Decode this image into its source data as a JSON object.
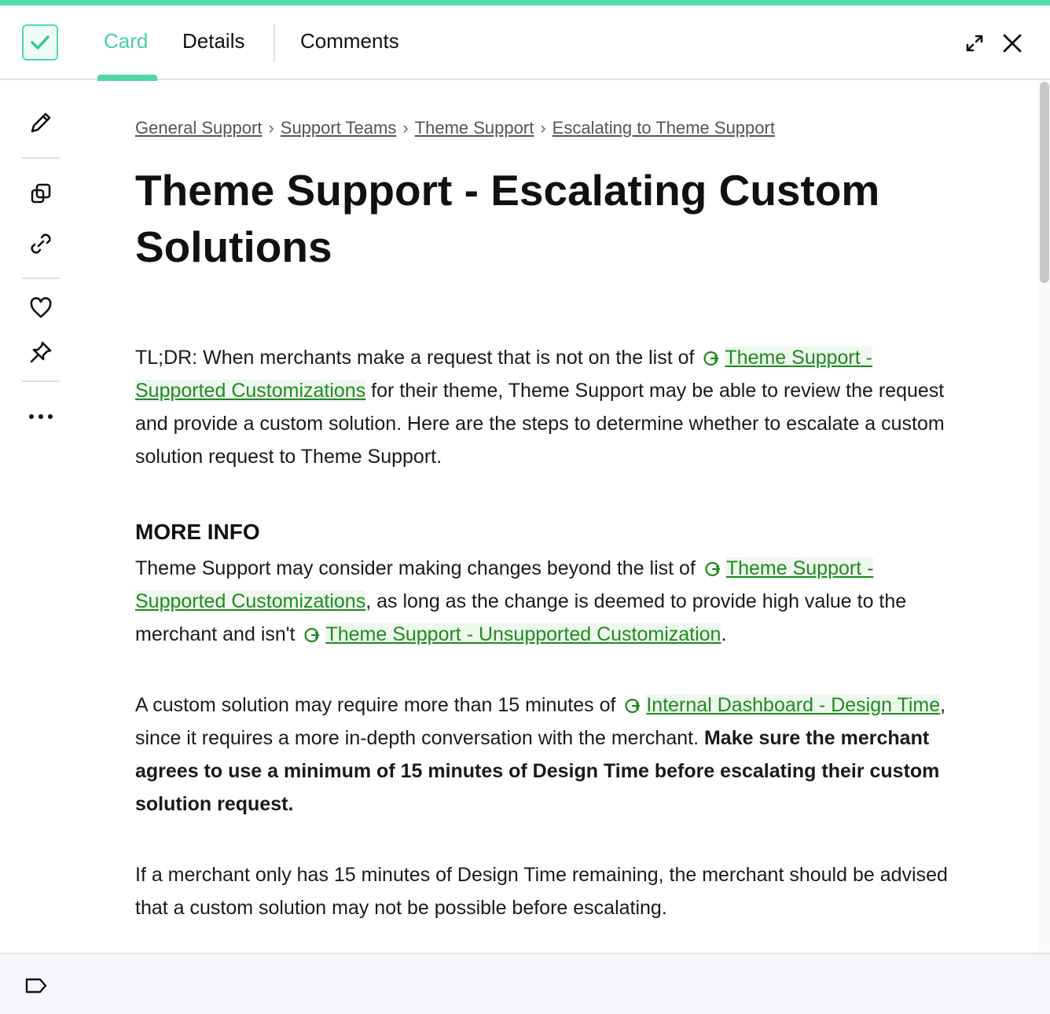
{
  "accent_color": "#4fdcb0",
  "link_color": "#1f8a1f",
  "header": {
    "tabs": [
      {
        "label": "Card",
        "active": true
      },
      {
        "label": "Details",
        "active": false
      },
      {
        "label": "Comments",
        "active": false
      }
    ],
    "icons": [
      "verified-check-icon",
      "expand-icon",
      "close-icon"
    ]
  },
  "sidebar": {
    "icons": [
      "pencil-icon",
      "copy-icon",
      "link-icon",
      "heart-icon",
      "pin-icon",
      "more-icon"
    ]
  },
  "breadcrumb": {
    "items": [
      "General Support",
      "Support Teams",
      "Theme Support",
      "Escalating to Theme Support"
    ],
    "separator": "›"
  },
  "card": {
    "title": "Theme Support - Escalating Custom Solutions",
    "p1": {
      "t1": "TL;DR: When merchants make a request that is not on the list of ",
      "link1": "Theme Support - Supported Customizations",
      "t2": " for their theme, Theme Support may be able to review the request and provide a custom solution. Here are the steps to determine whether to escalate a custom solution request to Theme Support."
    },
    "section_heading": "MORE INFO",
    "p2": {
      "t1": "Theme Support may consider making changes beyond the list of ",
      "link1": "Theme Support - Supported Customizations",
      "t2": ", as long as the change is deemed to provide high value to the merchant and isn't ",
      "link2": "Theme Support - Unsupported Customization",
      "t3": "."
    },
    "p3": {
      "t1": "A custom solution may require more than 15 minutes of ",
      "link1": "Internal Dashboard - Design Time",
      "t2": ", since it requires a more in-depth conversation with the merchant. ",
      "bold": "Make sure the merchant agrees to use a minimum of 15 minutes of Design Time before escalating their custom solution request."
    },
    "p4": "If a merchant only has 15 minutes of Design Time remaining, the merchant should be advised that a custom solution may not be possible before escalating."
  },
  "footer": {
    "icons": [
      "tag-icon"
    ]
  }
}
